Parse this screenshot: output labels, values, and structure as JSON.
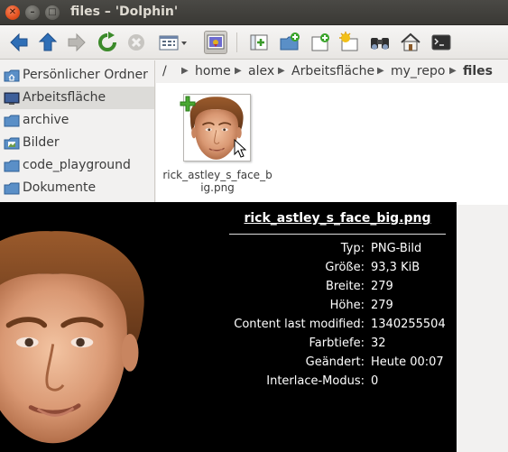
{
  "window": {
    "title": "files – 'Dolphin'",
    "close_glyph": "✕",
    "minimize_glyph": "–",
    "maximize_glyph": "□"
  },
  "toolbar": {
    "icons": [
      "back-icon",
      "up-icon",
      "forward-icon",
      "reload-icon",
      "stop-icon",
      "view-mode-icon",
      "preview-icon",
      "new-file-icon",
      "new-folder-icon",
      "new-tab-icon",
      "show-hidden-icon",
      "find-icon",
      "home-icon",
      "terminal-icon"
    ]
  },
  "sidebar": {
    "items": [
      {
        "label": "Persönlicher Ordner",
        "icon": "home-folder-icon"
      },
      {
        "label": "Arbeitsfläche",
        "icon": "desktop-icon"
      },
      {
        "label": "archive",
        "icon": "folder-icon"
      },
      {
        "label": "Bilder",
        "icon": "pictures-folder-icon"
      },
      {
        "label": "code_playground",
        "icon": "folder-icon"
      },
      {
        "label": "Dokumente",
        "icon": "folder-icon"
      }
    ],
    "selected": "Arbeitsfläche"
  },
  "breadcrumb": {
    "root": "/",
    "parts": [
      "home",
      "alex",
      "Arbeitsfläche",
      "my_repo",
      "files"
    ]
  },
  "files": [
    {
      "name": "rick_astley_s_face_big.png",
      "display": "rick_astley_s_face_big.png"
    }
  ],
  "tooltip": {
    "title": "rick_astley_s_face_big.png",
    "rows": [
      {
        "key": "Typ:",
        "value": "PNG-Bild"
      },
      {
        "key": "Größe:",
        "value": "93,3 KiB"
      },
      {
        "key": "Breite:",
        "value": "279"
      },
      {
        "key": "Höhe:",
        "value": "279"
      },
      {
        "key": "Content last modified:",
        "value": "1340255504"
      },
      {
        "key": "Farbtiefe:",
        "value": "32"
      },
      {
        "key": "Geändert:",
        "value": "Heute 00:07"
      },
      {
        "key": "Interlace-Modus:",
        "value": "0"
      }
    ]
  },
  "colors": {
    "titlebar": "#3c3b37",
    "accent_orange": "#e4501e",
    "tooltip_bg": "#000000",
    "selection": "#dcdbd8"
  }
}
